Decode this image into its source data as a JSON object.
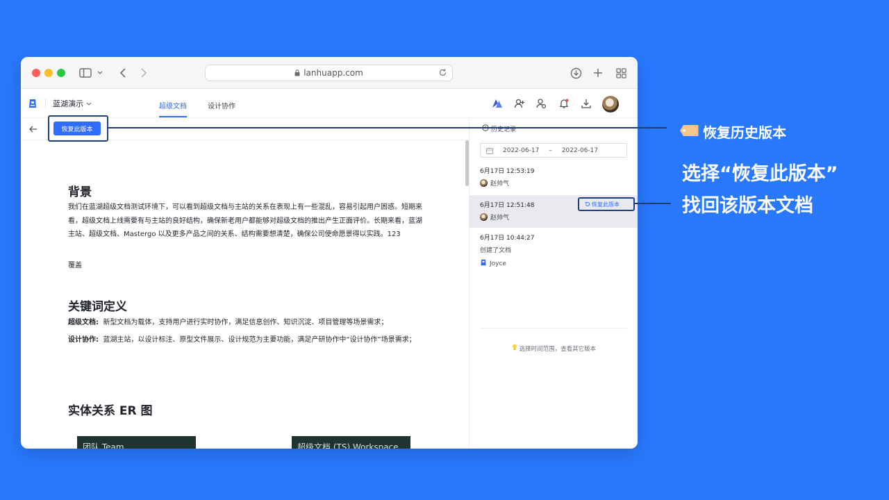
{
  "browser": {
    "url": "lanhuapp.com"
  },
  "app": {
    "workspace": "蓝湖演示",
    "tabs": [
      {
        "label": "超级文档",
        "active": true
      },
      {
        "label": "设计协作",
        "active": false
      }
    ]
  },
  "toolbar": {
    "restore_button": "恢复此版本"
  },
  "doc": {
    "sections": [
      {
        "heading": "背景"
      },
      {
        "heading": "关键词定义"
      },
      {
        "heading": "实体关系 ER 图"
      }
    ],
    "background_para": "我们在蓝湖超级文档测试环境下，可以看到超级文档与主站的关系在表现上有一些混乱，容易引起用户困惑。短期来看，超级文档上线需要有与主站的良好结构，确保新老用户都能够对超级文档的推出产生正面评价。长期来看，蓝湖主站、超级文档、Mastergo 以及更多产品之间的关系、结构需要想清楚，确保公司使命愿景得以实践。123",
    "overlay_word": "覆盖",
    "def_1_term": "超级文档:",
    "def_1_text": "新型文档为载体，支持用户进行实时协作，满足信息创作、知识沉淀、项目管理等场景需求；",
    "def_2_term": "设计协作:",
    "def_2_text": "蓝湖主站，以设计标注、原型文件展示、设计规范为主要功能，满足产研协作中“设计协作”场景需求；",
    "er_boxes": [
      "团队 Team",
      "超级文档 (TS) Workspace"
    ]
  },
  "history": {
    "title": "历史记录",
    "date_from": "2022-06-17",
    "date_sep": "–",
    "date_to": "2022-06-17",
    "versions": [
      {
        "time": "6月17日 12:53:19",
        "user": "赵帅气"
      },
      {
        "time": "6月17日 12:51:48",
        "user": "赵帅气",
        "restore": "恢复此版本",
        "selected": true
      },
      {
        "time": "6月17日 10:44:27",
        "note": "创建了文档",
        "user": "Joyce"
      }
    ],
    "hint": "选择时间范围，查看其它版本"
  },
  "callouts": {
    "title": "恢复历史版本",
    "line1": "选择“恢复此版本”",
    "line2": "找回该版本文档"
  },
  "colors": {
    "background": "#2979ff",
    "accent": "#2f6bff",
    "highlight": "#1c3f7a"
  }
}
